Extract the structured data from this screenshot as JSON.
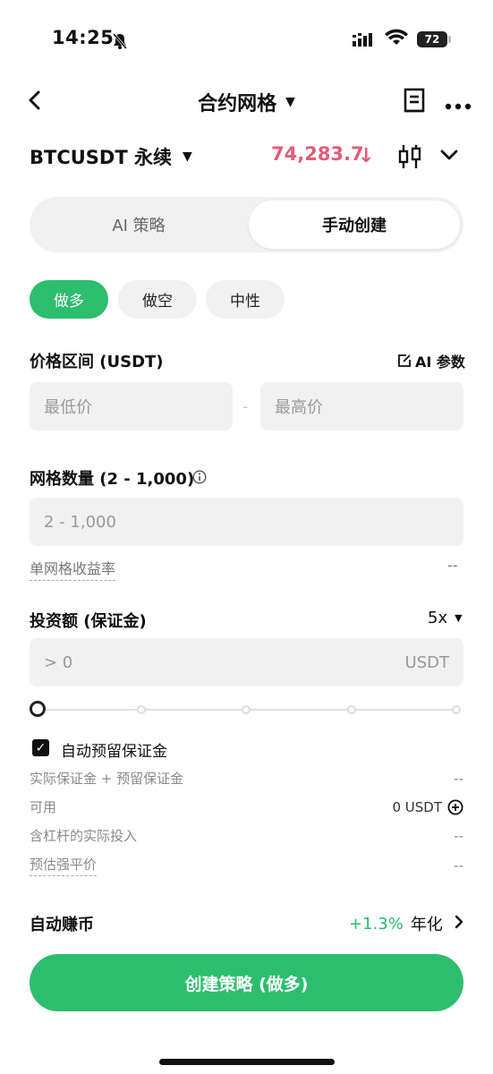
{
  "status": {
    "time": "14:25",
    "battery": "72"
  },
  "header": {
    "title": "合约网格"
  },
  "pair": {
    "symbol": "BTCUSDT 永续",
    "price": "74,283.7",
    "price_color": "#e05d7a"
  },
  "tabs": [
    {
      "label": "AI 策略",
      "active": false
    },
    {
      "label": "手动创建",
      "active": true
    }
  ],
  "direction": {
    "long": "做多",
    "short": "做空",
    "neutral": "中性",
    "accent": "#2dbd6e"
  },
  "price_range": {
    "label": "价格区间 (USDT)",
    "ai_param": "AI 参数",
    "min_placeholder": "最低价",
    "separator": "-",
    "max_placeholder": "最高价"
  },
  "grid": {
    "label": "网格数量 (2 - 1,000)",
    "placeholder": "2 - 1,000",
    "profit_label": "单网格收益率",
    "profit_value": "--"
  },
  "investment": {
    "label": "投资额 (保证金)",
    "leverage": "5x",
    "value": "> 0",
    "unit": "USDT",
    "slider_percent": 0
  },
  "auto_reserve": {
    "label": "自动预留保证金",
    "checked": true
  },
  "details": [
    {
      "label": "实际保证金 + 预留保证金",
      "value": "--"
    },
    {
      "label": "可用",
      "value": "0 USDT"
    },
    {
      "label": "含杠杆的实际投入",
      "value": "--"
    },
    {
      "label": "预估强平价",
      "value": "--"
    }
  ],
  "auto_earn": {
    "label": "自动赚币",
    "rate": "+1.3%",
    "suffix": "年化"
  },
  "cta": {
    "label": "创建策略 (做多)"
  }
}
